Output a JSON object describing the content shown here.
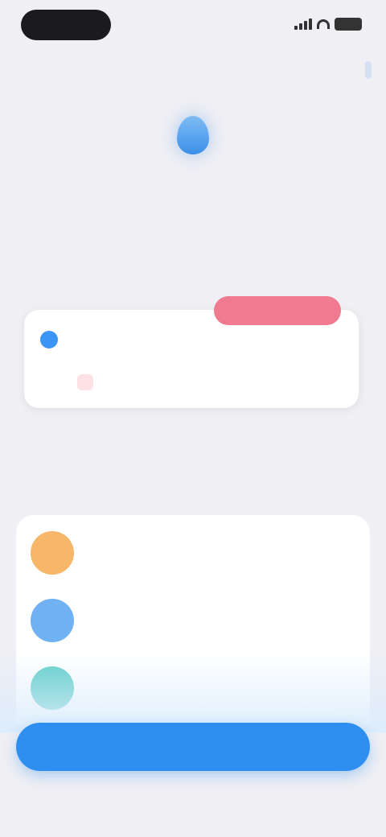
{
  "status_bar": {
    "time": ""
  },
  "header": {
    "action_label": ""
  },
  "hero": {
    "title": "",
    "subtitle": ""
  },
  "preview": {
    "badge": "",
    "name": "",
    "meta": "",
    "tag": "",
    "note": ""
  },
  "captions": {
    "left": "",
    "right": ""
  },
  "options": [
    {
      "title": "",
      "description": "",
      "icon": "orange-circle-icon",
      "color": "#f8b66b"
    },
    {
      "title": "",
      "description": "",
      "icon": "blue-circle-icon",
      "color": "#6fb1f2"
    },
    {
      "title": "",
      "description": "",
      "icon": "teal-circle-icon",
      "color": "#5fcdc8"
    }
  ],
  "cta": {
    "label": ""
  },
  "footnote": "",
  "colors": {
    "accent": "#2f8ff0",
    "badge": "#f07a8f",
    "background": "#efeff4"
  }
}
